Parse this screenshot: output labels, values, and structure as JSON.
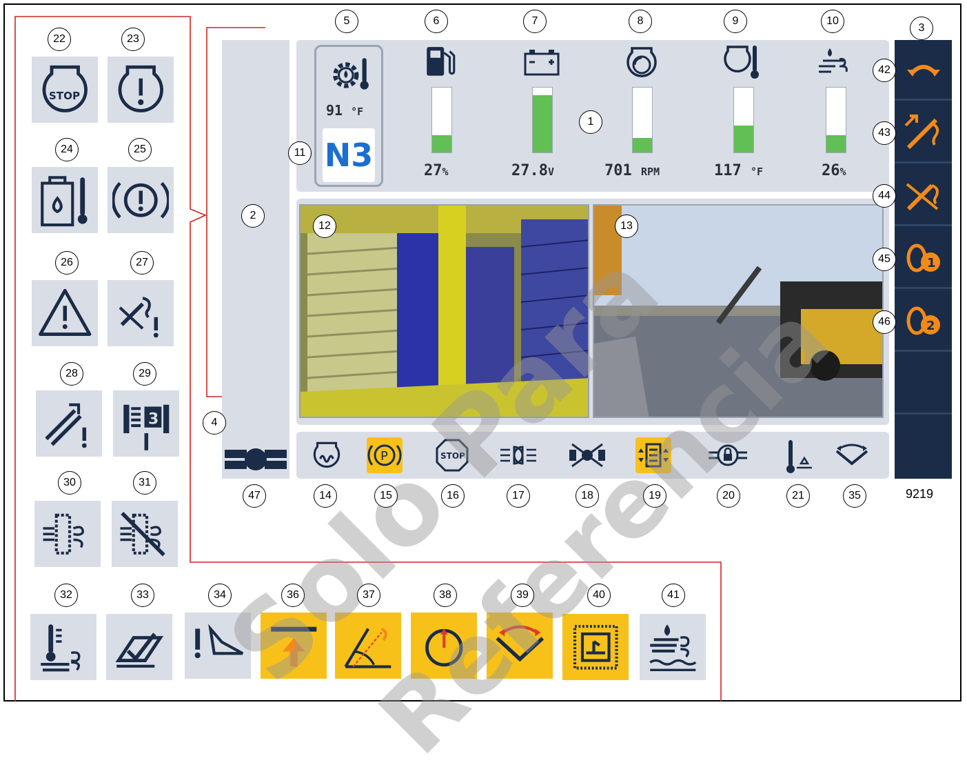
{
  "gauges": [
    {
      "label": "27",
      "unit": "%",
      "level": 0.27
    },
    {
      "label": "27.8",
      "unit": "V",
      "level": 0.88
    },
    {
      "label": "701",
      "unit": "RPM",
      "level": 0.22
    },
    {
      "label": "117",
      "unit": "°F",
      "level": 0.42
    },
    {
      "label": "26",
      "unit": "%",
      "level": 0.27
    }
  ],
  "transmission": {
    "temp_value": "91",
    "temp_unit": "°F",
    "gear": "N3"
  },
  "callouts": {
    "c1": "1",
    "c2": "2",
    "c3": "3",
    "c4": "4",
    "c5": "5",
    "c6": "6",
    "c7": "7",
    "c8": "8",
    "c9": "9",
    "c10": "10",
    "c11": "11",
    "c12": "12",
    "c13": "13",
    "c14": "14",
    "c15": "15",
    "c16": "16",
    "c17": "17",
    "c18": "18",
    "c19": "19",
    "c20": "20",
    "c21": "21",
    "c22": "22",
    "c23": "23",
    "c24": "24",
    "c25": "25",
    "c26": "26",
    "c27": "27",
    "c28": "28",
    "c29": "29",
    "c30": "30",
    "c31": "31",
    "c32": "32",
    "c33": "33",
    "c34": "34",
    "c35": "35",
    "c36": "36",
    "c37": "37",
    "c38": "38",
    "c39": "39",
    "c40": "40",
    "c41": "41",
    "c42": "42",
    "c43": "43",
    "c44": "44",
    "c45": "45",
    "c46": "46",
    "c47": "47"
  },
  "icons": {
    "t22": "engine-stop-icon",
    "t23": "engine-warning-icon",
    "t24": "hydraulic-oil-temp-icon",
    "t25": "brake-warning-icon",
    "t26": "general-warning-icon",
    "t27": "hook-block-warning-icon",
    "t28": "boom-extend-warning-icon",
    "t29": "winch-3-icon",
    "t30": "dpf-regeneration-icon",
    "t31": "dpf-inhibit-icon",
    "t32": "exhaust-temp-icon",
    "t33": "level-check-icon",
    "t34": "outrigger-warning-icon",
    "t36": "lift-up-icon",
    "t37": "boom-angle-icon",
    "t38": "swing-indicator-icon",
    "t39": "swing-range-icon",
    "t40": "work-area-icon",
    "t41": "def-quality-icon",
    "b14": "glow-plug-icon",
    "b15": "parking-brake-icon",
    "b16": "stop-icon",
    "b17": "headlights-icon",
    "b18": "axle-lock-icon",
    "b19": "suspension-icon",
    "b20": "differential-lock-icon",
    "b21": "coolant-level-icon",
    "b35": "swing-lock-icon",
    "r42": "swing-rotate-icon",
    "r43": "boom-telescope-icon",
    "r44": "hook-disable-icon",
    "r45": "winch-1-icon",
    "r46": "winch-2-icon"
  },
  "figure_id": "9219",
  "watermark": {
    "line1": "Solo Para",
    "line2": "Referencia"
  },
  "colors": {
    "panel": "#d9dde6",
    "rail": "#1a2c47",
    "accent_orange": "#f28a1a",
    "yellow": "#f7c11a",
    "green": "#62bf55",
    "gear_blue": "#1a6fd0",
    "bracket_red": "#d42222"
  }
}
